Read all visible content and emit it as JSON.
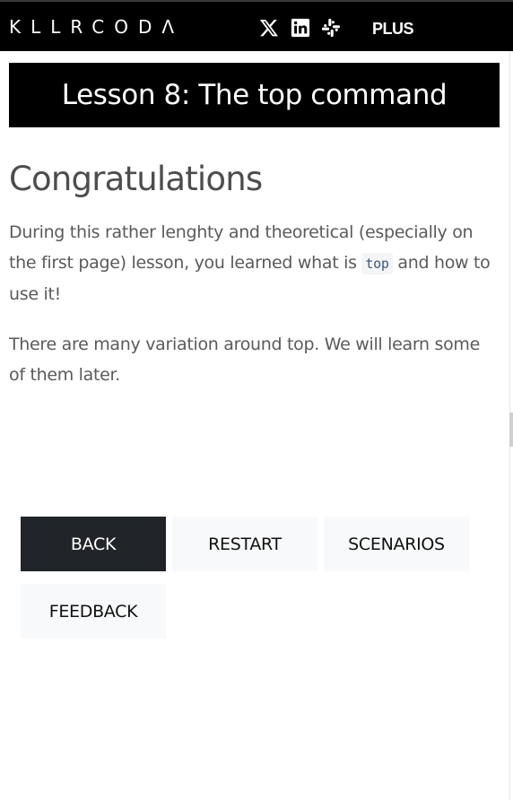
{
  "nav": {
    "logo_text": "KLLRCODΛ",
    "icons": [
      "x-icon",
      "linkedin-icon",
      "slack-icon"
    ],
    "plus_label": "PLUS"
  },
  "lesson": {
    "title": "Lesson 8: The top command"
  },
  "content": {
    "heading": "Congratulations",
    "p1_before": "During this rather lenghty and theoretical (especially on the first page) lesson, you learned what is ",
    "p1_code": "top",
    "p1_after": " and how to use it!",
    "p2": "There are many variation around top. We will learn some of them later."
  },
  "buttons": {
    "back": "BACK",
    "restart": "RESTART",
    "scenarios": "SCENARIOS",
    "feedback": "FEEDBACK"
  },
  "colors": {
    "nav_bg": "#000000",
    "banner_bg": "#000000",
    "primary_button": "#212529",
    "secondary_button": "#f8f9fa",
    "body_text": "#5a5a5a"
  }
}
